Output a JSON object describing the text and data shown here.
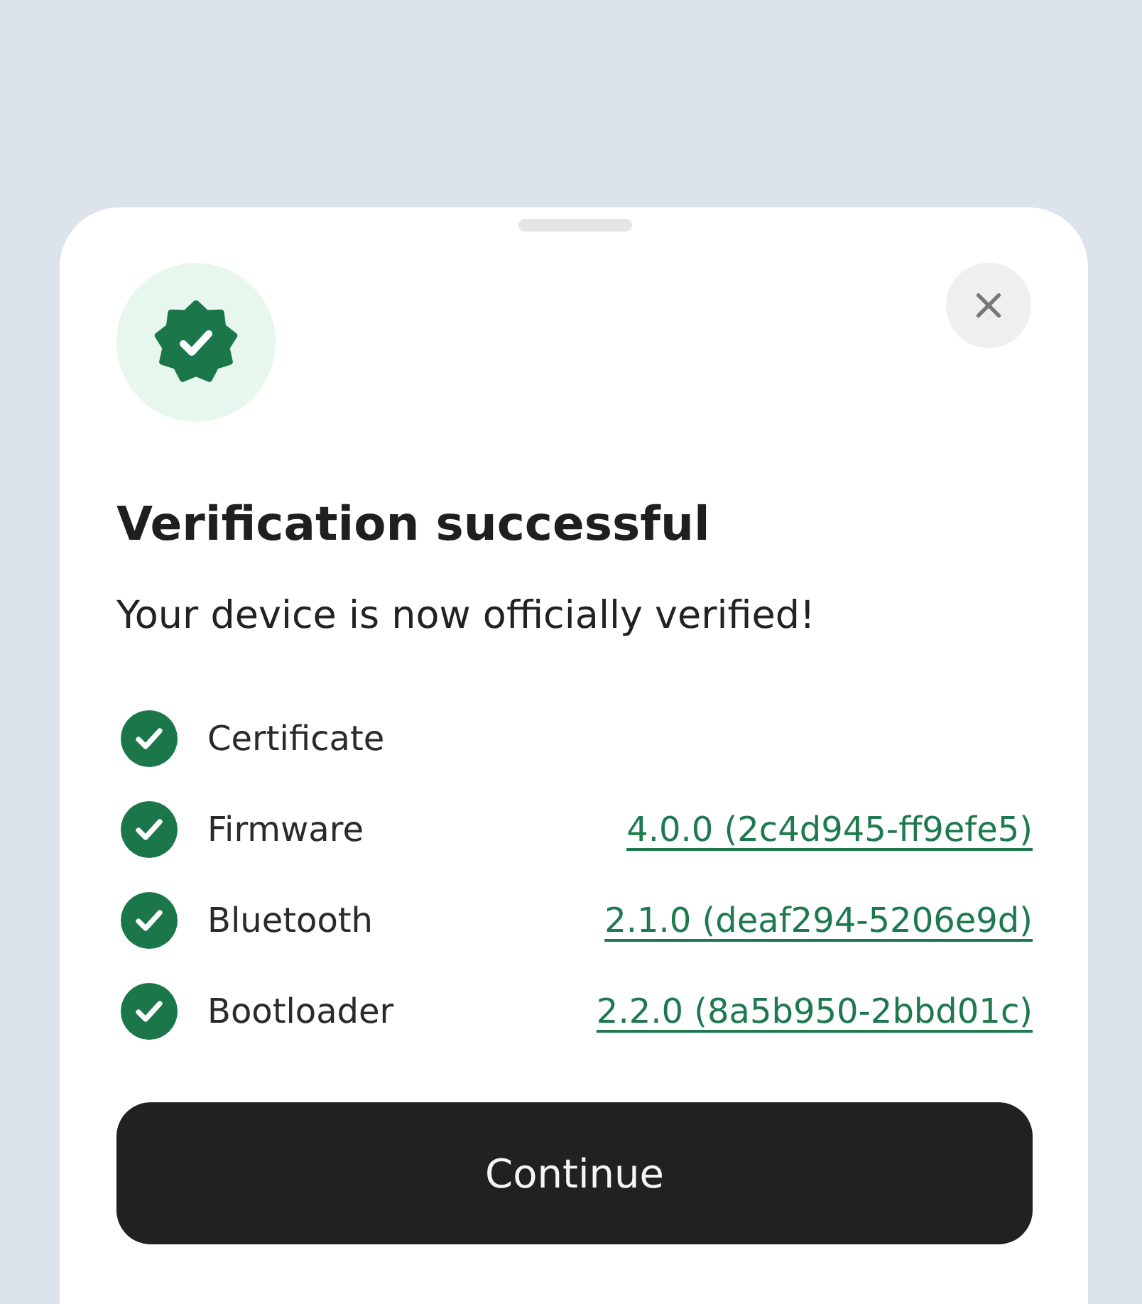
{
  "sheet": {
    "title": "Verification successful",
    "subtitle": "Your device is now officially verified!"
  },
  "items": [
    {
      "label": "Certificate",
      "verified": true
    },
    {
      "label": "Firmware",
      "verified": true,
      "version": "4.0.0 (2c4d945-ff9efe5)"
    },
    {
      "label": "Bluetooth",
      "verified": true,
      "version": "2.1.0 (deaf294-5206e9d)"
    },
    {
      "label": "Bootloader",
      "verified": true,
      "version": "2.2.0 (8a5b950-2bbd01c)"
    }
  ],
  "buttons": [
    {
      "label": "Continue",
      "kind": "primary"
    }
  ]
}
